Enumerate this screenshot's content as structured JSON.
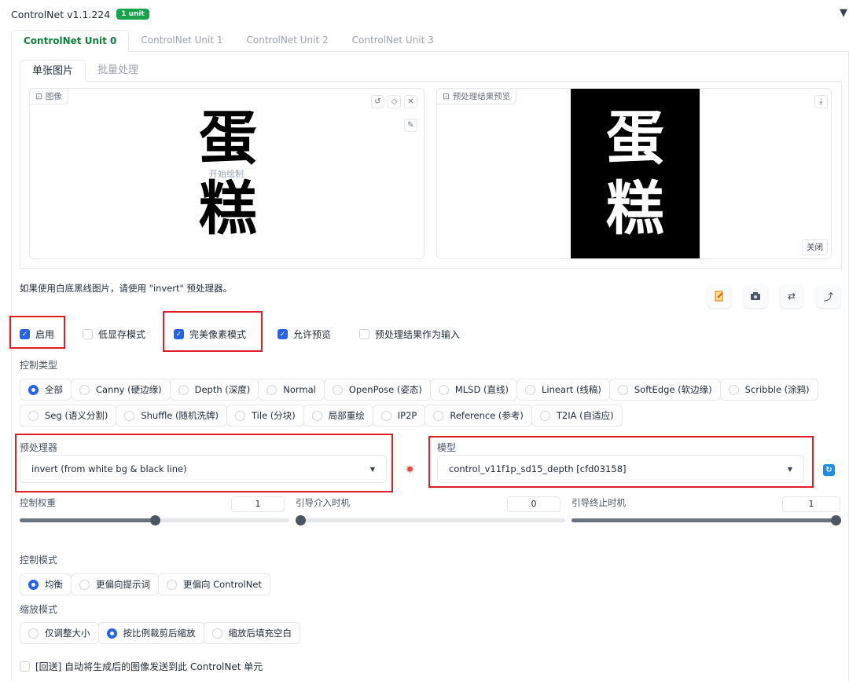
{
  "header": {
    "title": "ControlNet v1.1.224",
    "badge": "1 unit",
    "collapse_glyph": "▼"
  },
  "unit_tabs": [
    "ControlNet Unit 0",
    "ControlNet Unit 1",
    "ControlNet Unit 2",
    "ControlNet Unit 3"
  ],
  "image_tabs": [
    "单张图片",
    "批量处理"
  ],
  "input_image": {
    "label": "图像",
    "chars": [
      "蛋",
      "糕"
    ],
    "start_draw": "开始绘制",
    "icons": [
      "undo-icon",
      "eraser-icon",
      "close-icon",
      "brush-icon"
    ]
  },
  "preview_image": {
    "label": "预处理结果预览",
    "chars": [
      "蛋",
      "糕"
    ],
    "close_label": "关闭",
    "icons": [
      "download-icon"
    ]
  },
  "hint": "如果使用白底黑线图片，请使用 \"invert\" 预处理器。",
  "action_buttons": [
    "new-canvas-icon",
    "camera-icon",
    "swap-icon",
    "send-dimensions-icon"
  ],
  "checkboxes": [
    {
      "label": "启用",
      "checked": true
    },
    {
      "label": "低显存模式",
      "checked": false
    },
    {
      "label": "完美像素模式",
      "checked": true
    },
    {
      "label": "允许预览",
      "checked": true
    },
    {
      "label": "预处理结果作为输入",
      "checked": false
    }
  ],
  "control_type": {
    "label": "控制类型",
    "options": [
      "全部",
      "Canny (硬边缘)",
      "Depth (深度)",
      "Normal",
      "OpenPose (姿态)",
      "MLSD (直线)",
      "Lineart (线稿)",
      "SoftEdge (软边缘)",
      "Scribble (涂鸦)",
      "Seg (语义分割)",
      "Shuffle (随机洗牌)",
      "Tile (分块)",
      "局部重绘",
      "IP2P",
      "Reference (参考)",
      "T2IA (自适应)"
    ],
    "selected": "全部"
  },
  "preprocessor": {
    "label": "预处理器",
    "value": "invert (from white bg & black line)"
  },
  "model": {
    "label": "模型",
    "value": "control_v11f1p_sd15_depth [cfd03158]"
  },
  "sliders": [
    {
      "label": "控制权重",
      "value": "1",
      "fraction": 0.5
    },
    {
      "label": "引导介入时机",
      "value": "0",
      "fraction": 0.0
    },
    {
      "label": "引导终止时机",
      "value": "1",
      "fraction": 1.0
    }
  ],
  "control_mode": {
    "label": "控制模式",
    "options": [
      "均衡",
      "更偏向提示词",
      "更偏向 ControlNet"
    ],
    "selected": "均衡"
  },
  "resize_mode": {
    "label": "缩放模式",
    "options": [
      "仅调整大小",
      "按比例裁剪后缩放",
      "缩放后填充空白"
    ],
    "selected": "按比例裁剪后缩放"
  },
  "loopback": {
    "label": "[回送] 自动将生成后的图像发送到此 ControlNet 单元",
    "checked": false
  },
  "colors": {
    "accent": "#2563eb",
    "brand_green": "#16a34a",
    "highlight_red": "#e11d26"
  }
}
